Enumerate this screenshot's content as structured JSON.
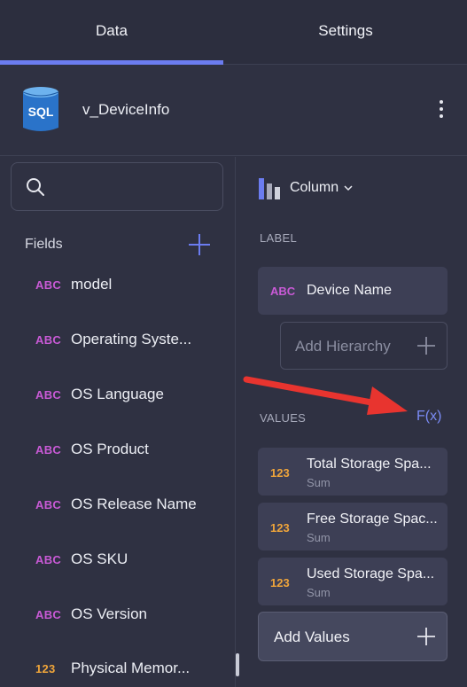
{
  "tabs": [
    {
      "label": "Data",
      "active": true
    },
    {
      "label": "Settings",
      "active": false
    }
  ],
  "source": {
    "icon_text": "SQL",
    "name": "v_DeviceInfo"
  },
  "search": {
    "placeholder": ""
  },
  "fields": {
    "header": "Fields",
    "items": [
      {
        "type": "ABC",
        "label": "model"
      },
      {
        "type": "ABC",
        "label": "Operating Syste..."
      },
      {
        "type": "ABC",
        "label": "OS Language"
      },
      {
        "type": "ABC",
        "label": "OS Product"
      },
      {
        "type": "ABC",
        "label": "OS Release Name"
      },
      {
        "type": "ABC",
        "label": "OS SKU"
      },
      {
        "type": "ABC",
        "label": "OS Version"
      },
      {
        "type": "123",
        "label": "Physical Memor..."
      }
    ]
  },
  "chart": {
    "type_label": "Column"
  },
  "label_section": {
    "title": "LABEL",
    "item": {
      "type": "ABC",
      "label": "Device Name"
    },
    "add_hierarchy": "Add Hierarchy"
  },
  "values_section": {
    "title": "VALUES",
    "fx_label": "F(x)",
    "items": [
      {
        "type": "123",
        "label": "Total Storage Spa...",
        "aggregation": "Sum"
      },
      {
        "type": "123",
        "label": "Free Storage Spac...",
        "aggregation": "Sum"
      },
      {
        "type": "123",
        "label": "Used Storage Spa...",
        "aggregation": "Sum"
      }
    ],
    "add_values": "Add Values"
  },
  "colors": {
    "accent": "#6b7cf0",
    "abc_type": "#c95ad6",
    "num_type": "#f0a53a",
    "annotation_arrow": "#e8342f"
  }
}
